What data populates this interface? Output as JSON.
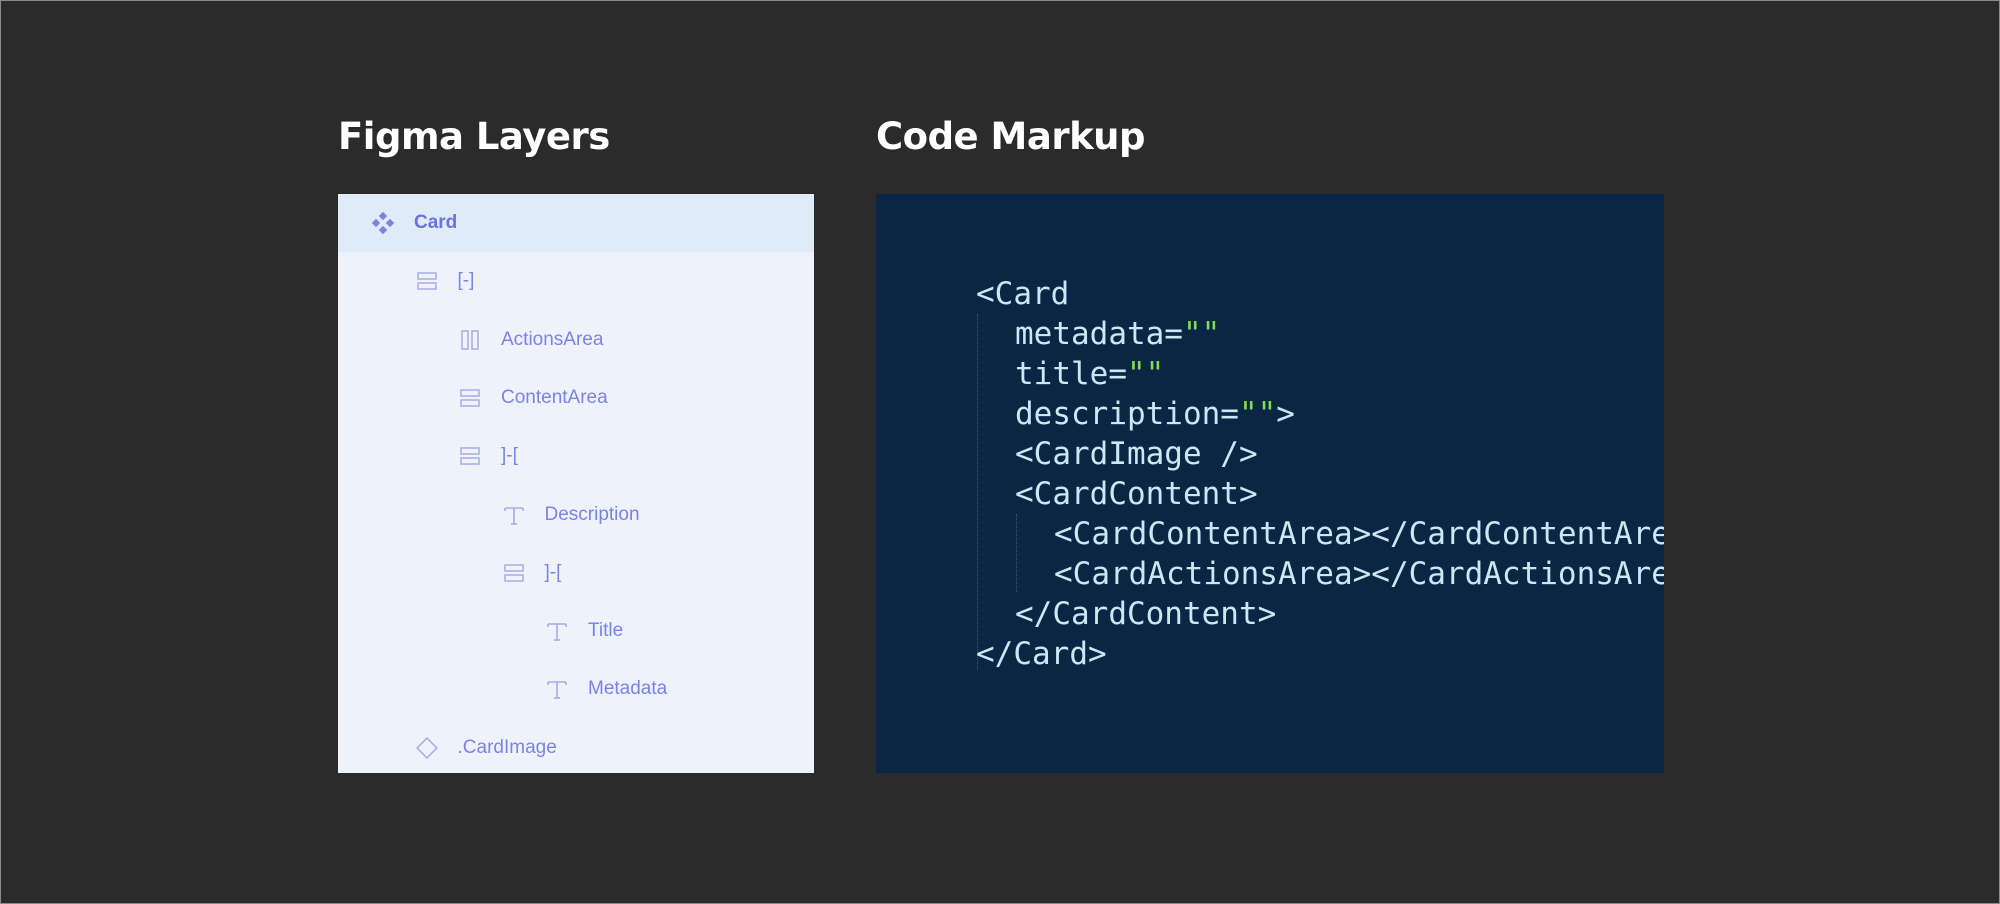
{
  "headings": {
    "left": "Figma Layers",
    "right": "Code Markup"
  },
  "layers": [
    {
      "label": "Card",
      "icon": "component-icon",
      "indent": 0,
      "selected": true
    },
    {
      "label": "[-]",
      "icon": "vertical-stack-icon",
      "indent": 1
    },
    {
      "label": "ActionsArea",
      "icon": "horizontal-stack-icon",
      "indent": 2
    },
    {
      "label": "ContentArea",
      "icon": "vertical-stack-icon",
      "indent": 2
    },
    {
      "label": "]-[",
      "icon": "vertical-stack-icon",
      "indent": 2
    },
    {
      "label": "Description",
      "icon": "text-icon",
      "indent": 3
    },
    {
      "label": "]-[",
      "icon": "vertical-stack-icon",
      "indent": 3
    },
    {
      "label": "Title",
      "icon": "text-icon",
      "indent": 4
    },
    {
      "label": "Metadata",
      "icon": "text-icon",
      "indent": 4
    },
    {
      "label": ".CardImage",
      "icon": "instance-icon",
      "indent": 1
    }
  ],
  "code": {
    "lines": [
      {
        "indent": 0,
        "parts": [
          {
            "t": "<Card"
          }
        ]
      },
      {
        "indent": 1,
        "parts": [
          {
            "t": "metadata="
          },
          {
            "t": "\"\"",
            "s": true
          }
        ]
      },
      {
        "indent": 1,
        "parts": [
          {
            "t": "title="
          },
          {
            "t": "\"\"",
            "s": true
          }
        ]
      },
      {
        "indent": 1,
        "parts": [
          {
            "t": "description="
          },
          {
            "t": "\"\"",
            "s": true
          },
          {
            "t": ">"
          }
        ]
      },
      {
        "indent": 1,
        "parts": [
          {
            "t": "<CardImage />"
          }
        ]
      },
      {
        "indent": 1,
        "parts": [
          {
            "t": "<CardContent>"
          }
        ]
      },
      {
        "indent": 2,
        "parts": [
          {
            "t": "<CardContentArea></CardContentArea>"
          }
        ]
      },
      {
        "indent": 2,
        "parts": [
          {
            "t": "<CardActionsArea></CardActionsArea>"
          }
        ]
      },
      {
        "indent": 1,
        "parts": [
          {
            "t": "</CardContent>"
          }
        ]
      },
      {
        "indent": 0,
        "parts": [
          {
            "t": "</Card>"
          }
        ]
      }
    ]
  },
  "colors": {
    "background": "#2b2b2b",
    "layers_panel": "#eef3fb",
    "layers_selected": "#e0ebf8",
    "layer_text": "#7c83e6",
    "code_panel": "#0b2545",
    "code_text": "#c8e9f2",
    "code_string": "#7ed957"
  }
}
